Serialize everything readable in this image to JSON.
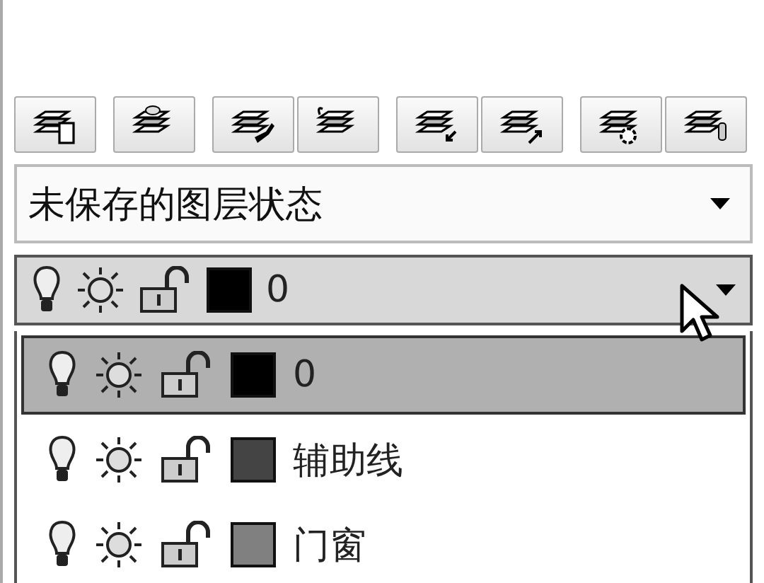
{
  "layer_state_dropdown": {
    "value": "未保存的图层状态"
  },
  "current_layer": {
    "name": "0",
    "color": "#000000"
  },
  "layer_list": [
    {
      "name": "0",
      "color": "#000000",
      "selected": true
    },
    {
      "name": "辅助线",
      "color": "#444444",
      "selected": false
    },
    {
      "name": "门窗",
      "color": "#808080",
      "selected": false
    }
  ]
}
